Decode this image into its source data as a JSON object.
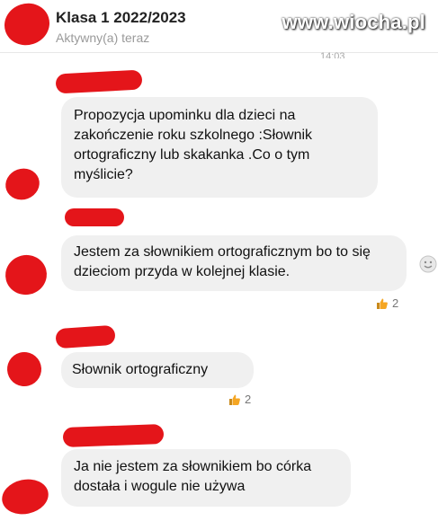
{
  "header": {
    "title": "Klasa 1 2022/2023",
    "status": "Aktywny(a) teraz"
  },
  "watermark": "www.wiocha.pl",
  "time_partial": "14:03",
  "messages": [
    {
      "text": "Propozycja upominku dla dzieci na zakończenie roku szkolnego :Słownik ortograficzny lub skakanka .Co o tym myślicie?"
    },
    {
      "text": "Jestem za słownikiem ortograficznym bo to się dzieciom przyda w kolejnej klasie.",
      "reaction_count": "2"
    },
    {
      "text": "Słownik ortograficzny",
      "reaction_count": "2"
    },
    {
      "text": "Ja nie jestem za słownikiem bo córka dostała i wogule nie używa"
    }
  ],
  "colors": {
    "redaction": "#e4151a",
    "bubble": "#f0f0f0",
    "like_accent": "#f5a623"
  }
}
